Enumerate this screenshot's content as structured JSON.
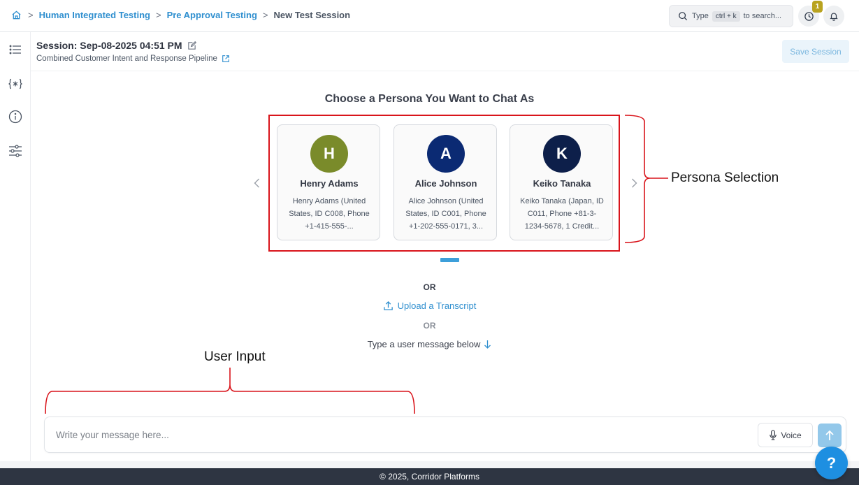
{
  "breadcrumb": {
    "items": [
      "Human Integrated Testing",
      "Pre Approval Testing"
    ],
    "current": "New Test Session"
  },
  "search": {
    "prefix": "Type",
    "shortcut": "ctrl + k",
    "suffix": "to search..."
  },
  "notifications": {
    "history_count": "1"
  },
  "session": {
    "title": "Session: Sep-08-2025 04:51 PM",
    "pipeline": "Combined Customer Intent and Response Pipeline",
    "save_label": "Save Session"
  },
  "persona": {
    "heading": "Choose a Persona You Want to Chat As",
    "cards": [
      {
        "initial": "H",
        "name": "Henry Adams",
        "desc": "Henry Adams (United States, ID C008, Phone +1-415-555-...",
        "color": "#7a8b2a"
      },
      {
        "initial": "A",
        "name": "Alice Johnson",
        "desc": "Alice Johnson (United States, ID C001, Phone +1-202-555-0171, 3...",
        "color": "#0b2a73"
      },
      {
        "initial": "K",
        "name": "Keiko Tanaka",
        "desc": "Keiko Tanaka (Japan, ID C011, Phone +81-3-1234-5678, 1 Credit...",
        "color": "#0d1f4a"
      }
    ]
  },
  "annotations": {
    "persona_selection": "Persona Selection",
    "user_input": "User Input"
  },
  "alternatives": {
    "or_1": "OR",
    "upload": "Upload a Transcript",
    "or_2": "OR",
    "type_below": "Type a user message below"
  },
  "composer": {
    "placeholder": "Write your message here...",
    "voice_label": "Voice"
  },
  "footer": {
    "text": "© 2025, Corridor Platforms",
    "help": "?"
  },
  "colors": {
    "accent": "#2f8fcf",
    "annotation_red": "#d9141b"
  }
}
